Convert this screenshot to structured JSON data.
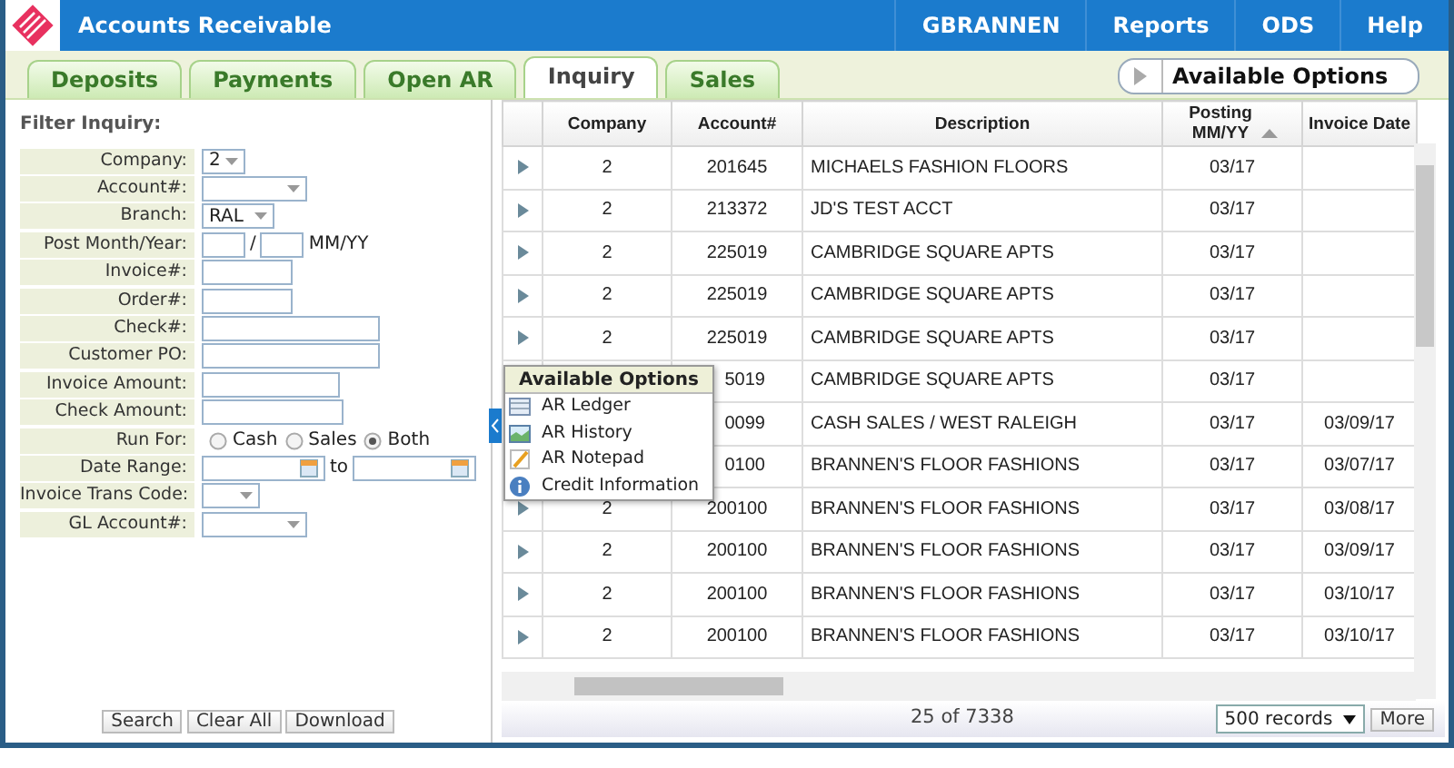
{
  "app": {
    "title": "Accounts Receivable",
    "menu": [
      "GBRANNEN",
      "Reports",
      "ODS",
      "Help"
    ]
  },
  "tabs": [
    {
      "label": "Deposits",
      "selected": false
    },
    {
      "label": "Payments",
      "selected": false
    },
    {
      "label": "Open AR",
      "selected": false
    },
    {
      "label": "Inquiry",
      "selected": true
    },
    {
      "label": "Sales",
      "selected": false
    }
  ],
  "options_button": {
    "label": "Available Options"
  },
  "filter": {
    "title": "Filter Inquiry:",
    "fields": [
      {
        "label": "Company:",
        "kind": "select",
        "value": "2"
      },
      {
        "label": "Account#:",
        "kind": "select"
      },
      {
        "label": "Branch:",
        "kind": "select",
        "value": "RAL"
      },
      {
        "label": "Post Month/Year:",
        "kind": "month",
        "separator": "/",
        "hint": "MM/YY"
      },
      {
        "label": "Invoice#:",
        "kind": "input"
      },
      {
        "label": "Order#:",
        "kind": "input"
      },
      {
        "label": "Check#:",
        "kind": "input"
      },
      {
        "label": "Customer PO:",
        "kind": "input"
      },
      {
        "label": "Invoice Amount:",
        "kind": "input"
      },
      {
        "label": "Check Amount:",
        "kind": "input"
      },
      {
        "label": "Run For:",
        "kind": "radio",
        "options": [
          {
            "label": "Cash",
            "selected": false
          },
          {
            "label": "Sales",
            "selected": false
          },
          {
            "label": "Both",
            "selected": true
          }
        ]
      },
      {
        "label": "Date Range:",
        "kind": "daterange",
        "separator": "to"
      },
      {
        "label": "Invoice Trans Code:",
        "kind": "select"
      },
      {
        "label": "GL Account#:",
        "kind": "select"
      }
    ],
    "buttons": [
      "Search",
      "Clear All",
      "Download"
    ]
  },
  "table": {
    "columns": [
      "Company",
      "Account#",
      "Description",
      "Posting MM/YY",
      "Invoice Date"
    ],
    "rows": [
      {
        "company": "2",
        "account": "201645",
        "description": "MICHAELS FASHION FLOORS",
        "posting": "03/17",
        "invoice_date": ""
      },
      {
        "company": "2",
        "account": "213372",
        "description": "JD'S TEST ACCT",
        "posting": "03/17",
        "invoice_date": ""
      },
      {
        "company": "2",
        "account": "225019",
        "description": "CAMBRIDGE SQUARE APTS",
        "posting": "03/17",
        "invoice_date": ""
      },
      {
        "company": "2",
        "account": "225019",
        "description": "CAMBRIDGE SQUARE APTS",
        "posting": "03/17",
        "invoice_date": ""
      },
      {
        "company": "2",
        "account": "225019",
        "description": "CAMBRIDGE SQUARE APTS",
        "posting": "03/17",
        "invoice_date": ""
      },
      {
        "account": "5019",
        "description": "CAMBRIDGE SQUARE APTS",
        "posting": "03/17",
        "invoice_date": ""
      },
      {
        "account": "0099",
        "description": "CASH SALES / WEST RALEIGH",
        "posting": "03/17",
        "invoice_date": "03/09/17"
      },
      {
        "account": "0100",
        "description": "BRANNEN'S FLOOR FASHIONS",
        "posting": "03/17",
        "invoice_date": "03/07/17"
      },
      {
        "company": "2",
        "account": "200100",
        "description": "BRANNEN'S FLOOR FASHIONS",
        "posting": "03/17",
        "invoice_date": "03/08/17"
      },
      {
        "company": "2",
        "account": "200100",
        "description": "BRANNEN'S FLOOR FASHIONS",
        "posting": "03/17",
        "invoice_date": "03/09/17"
      },
      {
        "company": "2",
        "account": "200100",
        "description": "BRANNEN'S FLOOR FASHIONS",
        "posting": "03/17",
        "invoice_date": "03/10/17"
      },
      {
        "company": "2",
        "account": "200100",
        "description": "BRANNEN'S FLOOR FASHIONS",
        "posting": "03/17",
        "invoice_date": "03/10/17"
      }
    ],
    "count": "25 of 7338",
    "page_size": "500 records",
    "more": "More"
  },
  "popup": {
    "title": "Available Options",
    "items": [
      {
        "label": "AR Ledger",
        "kind": "ledger"
      },
      {
        "label": "AR History",
        "kind": "history"
      },
      {
        "label": "AR Notepad",
        "kind": "notepad"
      },
      {
        "label": "Credit Information",
        "kind": "info"
      }
    ]
  }
}
